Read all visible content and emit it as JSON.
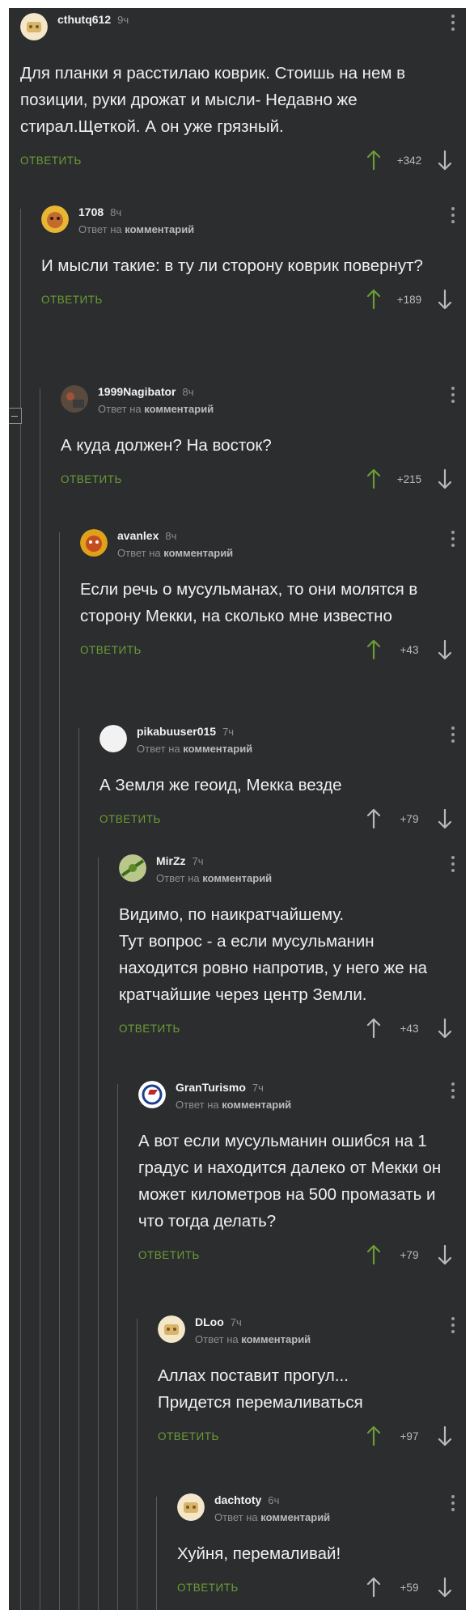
{
  "reply_to_label": "Ответ на",
  "reply_to_target": "комментарий",
  "reply_button": "ОТВЕТИТЬ",
  "icons": {
    "vote_up": "arrow-up-icon",
    "vote_down": "arrow-down-icon",
    "menu": "more-vertical-icon",
    "collapse": "collapse-thread-icon"
  },
  "colors": {
    "background": "#2b2d2f",
    "reply": "#6b9c35",
    "upvote": "#6b9c35",
    "text": "#f0f0f0",
    "muted": "#8b8e91"
  },
  "comments": [
    {
      "author": "cthutq612",
      "time": "9ч",
      "text": "Для планки я расстилаю коврик. Стоишь на нем в позиции, руки дрожат и мысли- Недавно же стирал.Щеткой. А он уже грязный.",
      "score": "+342",
      "is_reply": false,
      "upvoted": true
    },
    {
      "author": "1708",
      "time": "8ч",
      "text": "И мысли такие: в ту ли сторону коврик повернут?",
      "score": "+189",
      "is_reply": true,
      "upvoted": true
    },
    {
      "author": "1999Nagibator",
      "time": "8ч",
      "text": "А куда должен? На восток?",
      "score": "+215",
      "is_reply": true,
      "upvoted": true
    },
    {
      "author": "avanlex",
      "time": "8ч",
      "text": "Если речь о мусульманах, то они молятся в сторону Мекки, на сколько мне известно",
      "score": "+43",
      "is_reply": true,
      "upvoted": true
    },
    {
      "author": "pikabuuser015",
      "time": "7ч",
      "text": "А Земля же геоид, Мекка везде",
      "score": "+79",
      "is_reply": true,
      "upvoted": false
    },
    {
      "author": "MirZz",
      "time": "7ч",
      "text": "Видимо, по наикратчайшему.\nТут вопрос - а если мусульманин находится ровно напротив, у него же на кратчайшие через центр Земли.",
      "score": "+43",
      "is_reply": true,
      "upvoted": false
    },
    {
      "author": "GranTurismo",
      "time": "7ч",
      "text": "А вот если мусульманин ошибся на 1 градус и находится далеко от Мекки он может километров на 500 промазать и что тогда делать?",
      "score": "+79",
      "is_reply": true,
      "upvoted": true
    },
    {
      "author": "DLoo",
      "time": "7ч",
      "text": "Аллах поставит прогул...\nПридется перемаливаться",
      "score": "+97",
      "is_reply": true,
      "upvoted": true
    },
    {
      "author": "dachtoty",
      "time": "6ч",
      "text": "Хуйня, перемаливай!",
      "score": "+59",
      "is_reply": true,
      "upvoted": false
    }
  ]
}
